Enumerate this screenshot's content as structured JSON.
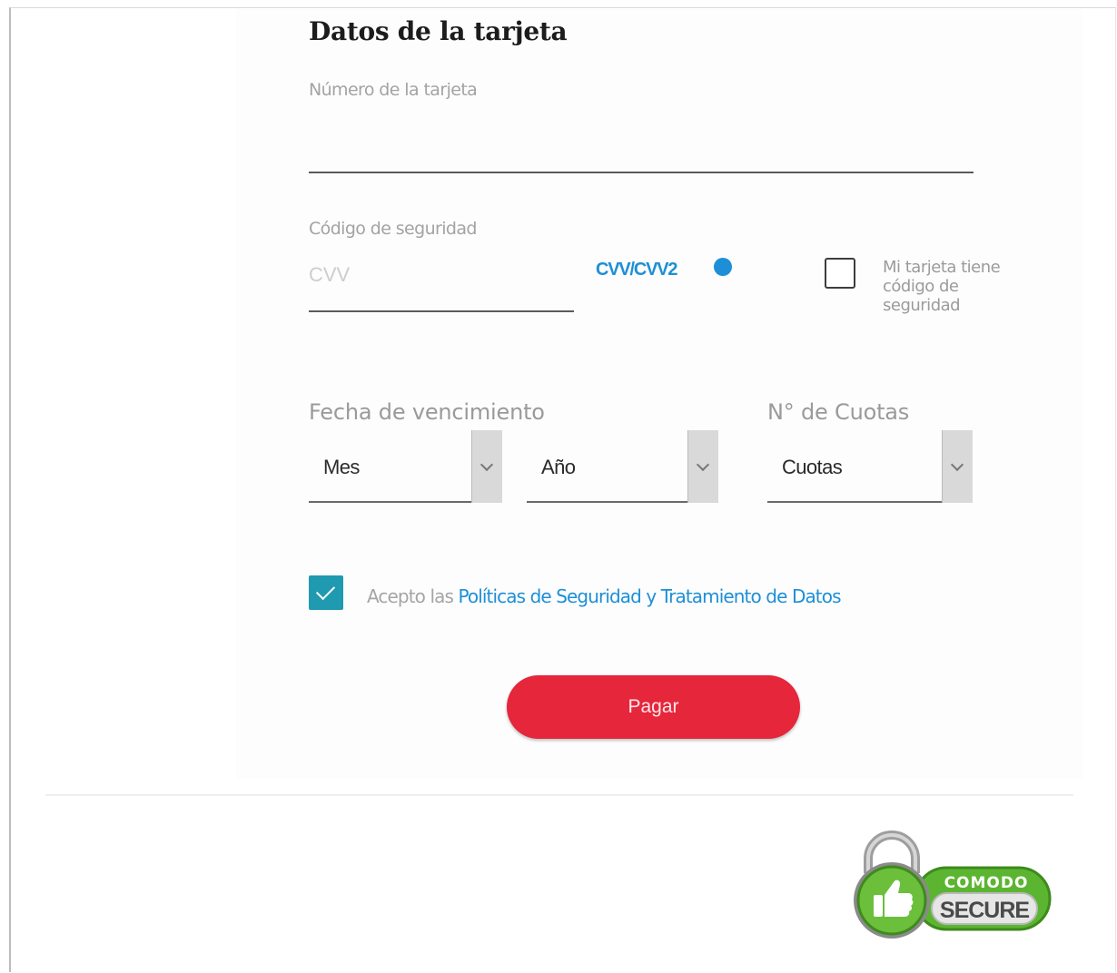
{
  "form": {
    "title": "Datos de la tarjeta",
    "card_number": {
      "label": "Número de la tarjeta",
      "value": "",
      "placeholder": ""
    },
    "security_code": {
      "label": "Código de seguridad",
      "placeholder": "CVV",
      "help_link": "CVV/CVV2",
      "checkbox_label": "Mi tarjeta tiene código de seguridad",
      "checkbox_checked": false
    },
    "expiry": {
      "label": "Fecha de vencimiento",
      "month": {
        "selected": "Mes"
      },
      "year": {
        "selected": "Año"
      }
    },
    "installments": {
      "label": "N° de Cuotas",
      "selected": "Cuotas"
    },
    "accept": {
      "checked": true,
      "prefix": "Acepto las ",
      "link": "Políticas de Seguridad y Tratamiento de Datos"
    },
    "pay_button": "Pagar"
  },
  "seal": {
    "brand": "COMODO",
    "text": "SECURE",
    "icons": [
      "padlock-icon",
      "thumbs-up-icon"
    ]
  },
  "colors": {
    "title": "#1c1c1c",
    "link": "#1d8fd6",
    "checkbox_checked": "#1f9ab0",
    "pay_button": "#e5263b",
    "seal_green": "#5cb531"
  }
}
